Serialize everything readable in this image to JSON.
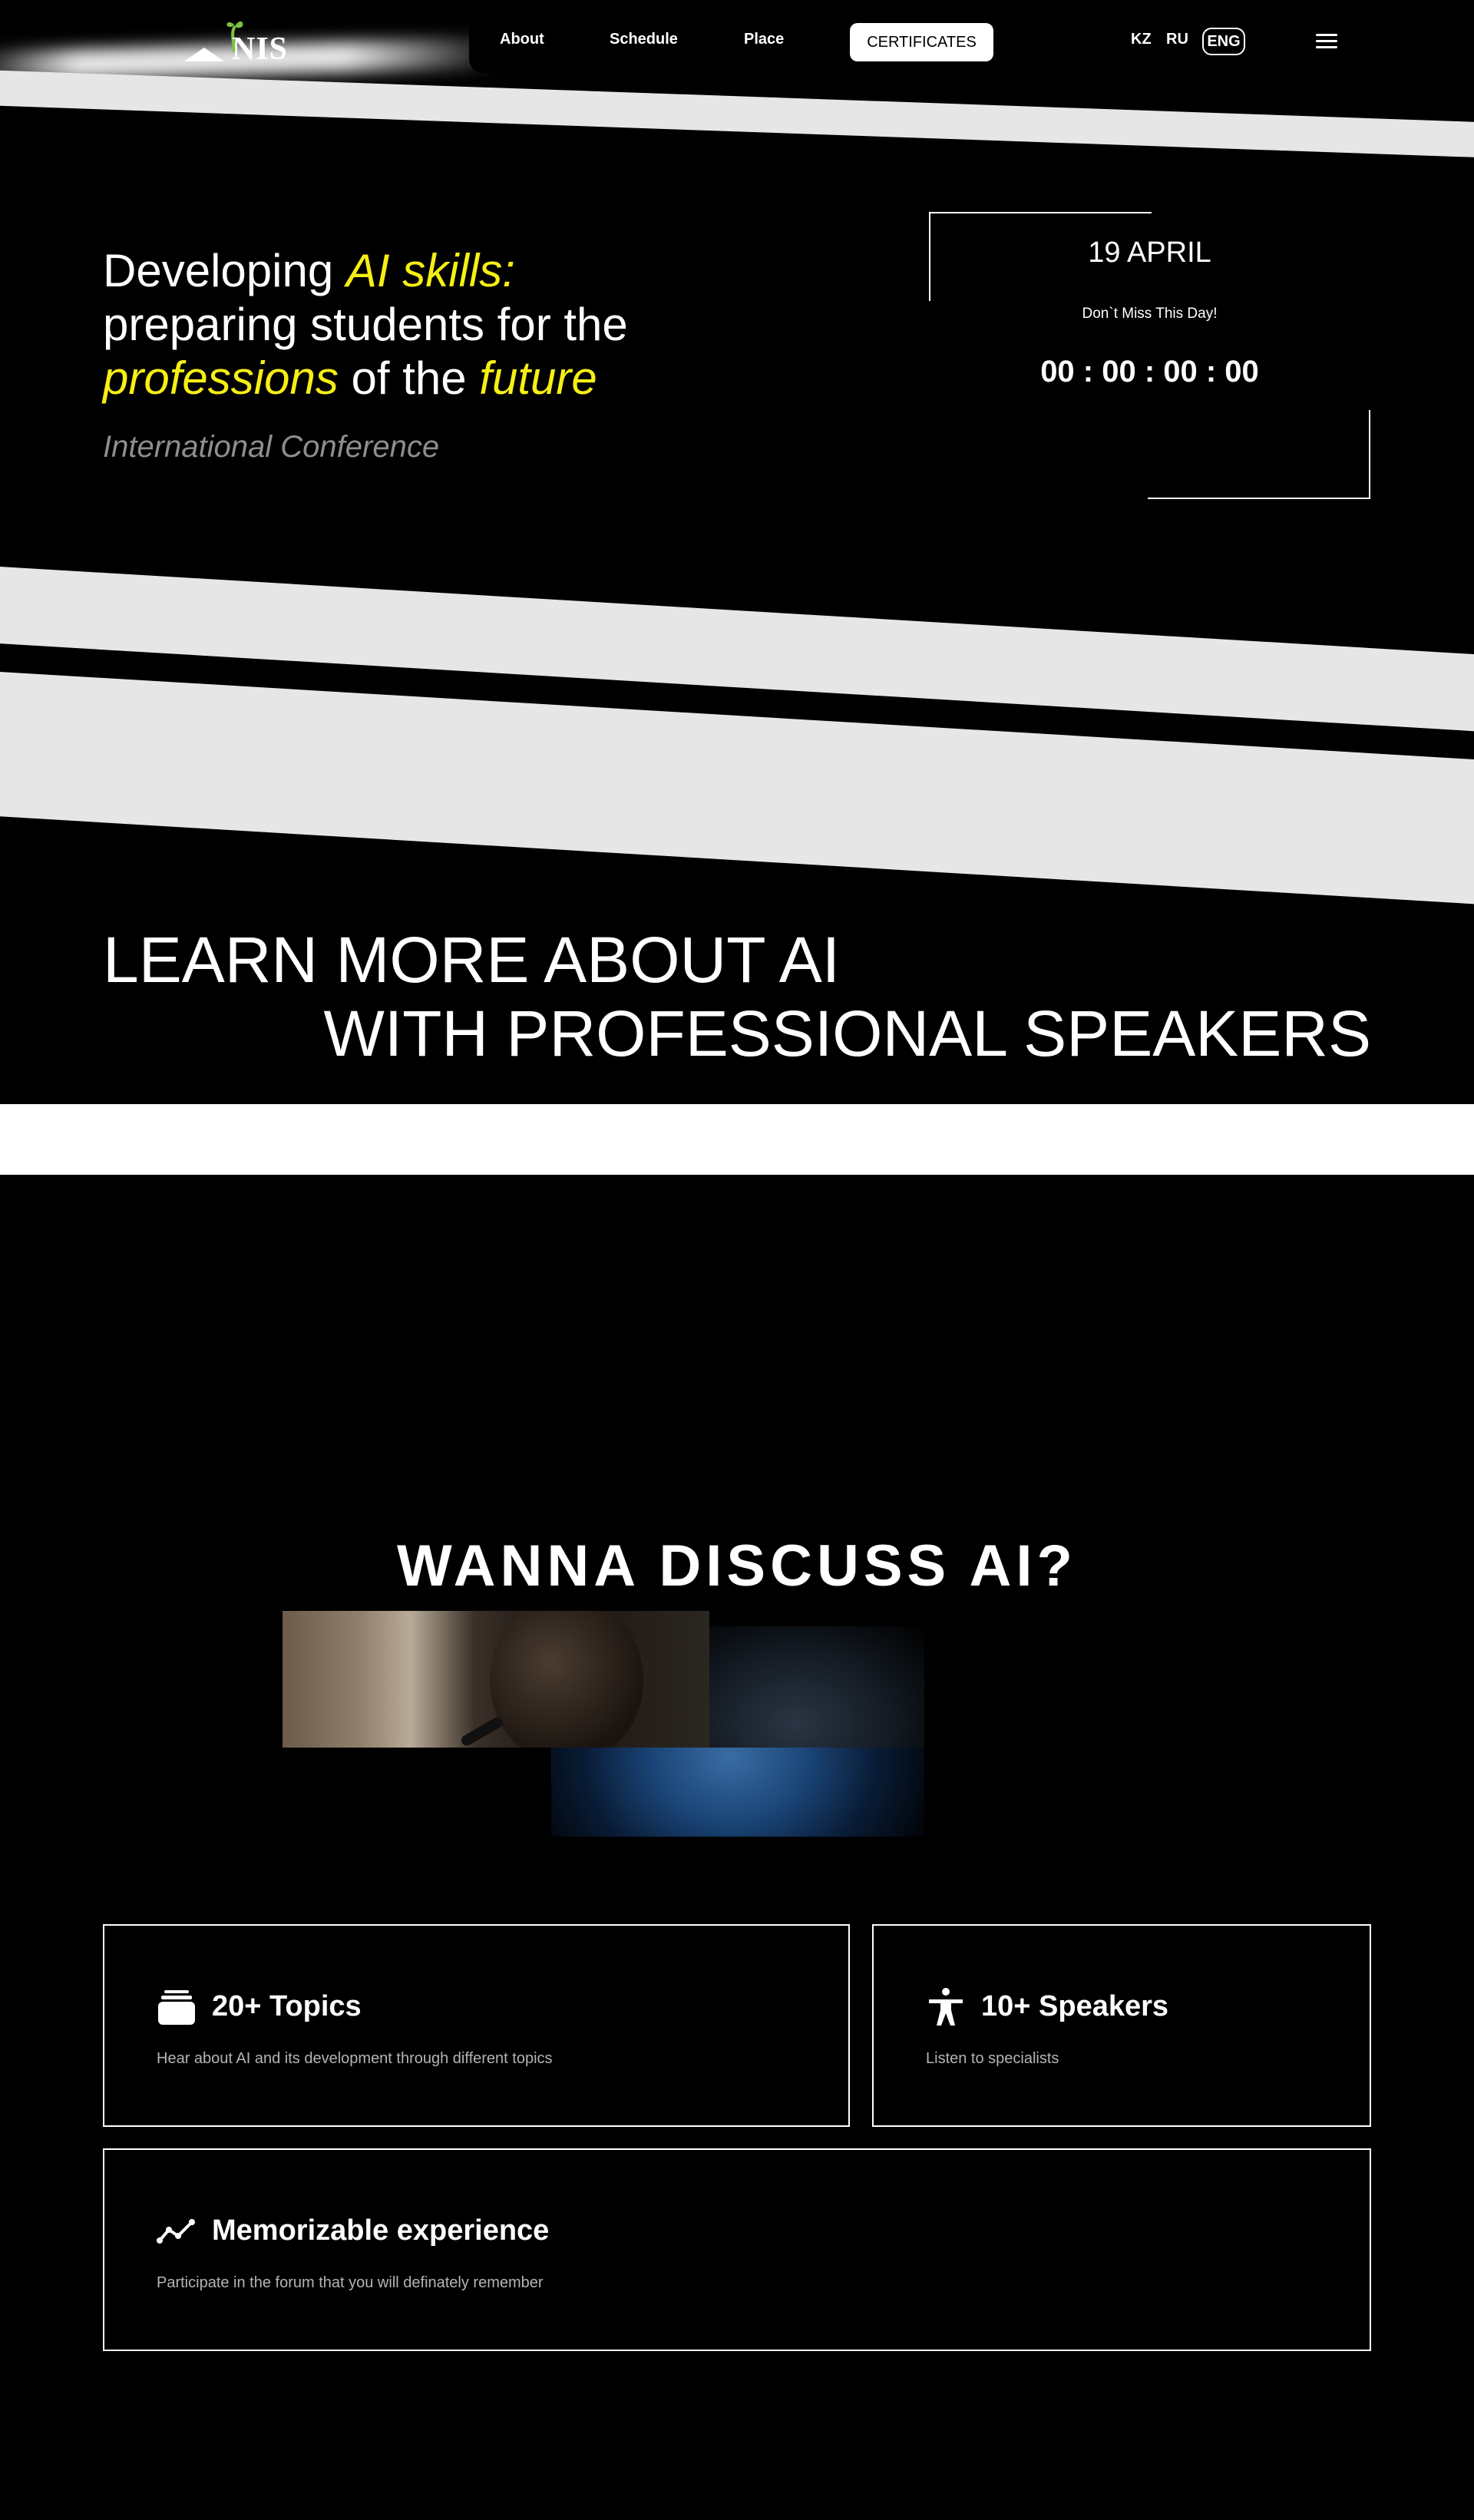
{
  "header": {
    "logo_text": "NIS",
    "nav": {
      "about": "About",
      "schedule": "Schedule",
      "place": "Place",
      "certificates": "CERTIFICATES"
    },
    "languages": [
      "KZ",
      "RU",
      "ENG"
    ],
    "active_language": "ENG",
    "menu_icon": "hamburger-menu-icon"
  },
  "hero": {
    "title_part1": "Developing ",
    "title_highlight1": "AI skills:",
    "title_part2": "preparing students for the",
    "title_highlight2": "professions",
    "title_part3": " of the ",
    "title_highlight3": "future",
    "subtitle": "International Conference",
    "highlight_color": "#f6ef15"
  },
  "countdown": {
    "date": "19 APRIL",
    "tagline": "Don`t Miss This Day!",
    "timer": "00 : 00 : 00 : 00"
  },
  "learn": {
    "line1": "LEARN MORE ABOUT AI",
    "line2": "WITH PROFESSIONAL SPEAKERS"
  },
  "discuss": {
    "title": "WANNA DISCUSS AI?"
  },
  "features": [
    {
      "icon": "stack-icon",
      "title": "20+ Topics",
      "description": "Hear about AI and its development through different topics"
    },
    {
      "icon": "person-icon",
      "title": "10+ Speakers",
      "description": "Listen to specialists"
    },
    {
      "icon": "trend-line-icon",
      "title": "Memorizable experience",
      "description": "Participate in the forum that you will definately remember"
    }
  ]
}
